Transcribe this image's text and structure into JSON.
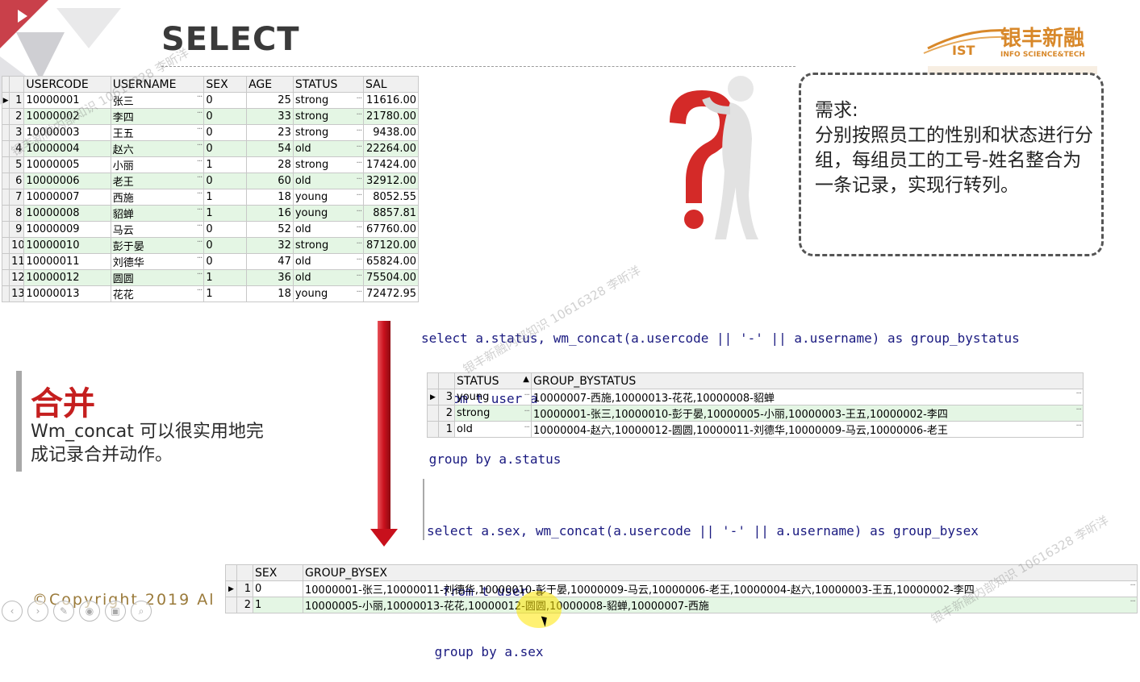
{
  "slide": {
    "title": "SELECT",
    "brand": {
      "name": "银丰新融",
      "abbr": "IST",
      "sub": "INFO SCIENCE&TECH"
    },
    "copyright": "©Copyright 2019 Al",
    "watermark": "银丰新融内部知识 10616328 李昕洋"
  },
  "user_table": {
    "columns": [
      "USERCODE",
      "USERNAME",
      "SEX",
      "AGE",
      "STATUS",
      "SAL"
    ],
    "rows": [
      {
        "n": "1",
        "code": "10000001",
        "name": "张三",
        "sex": "0",
        "age": "25",
        "status": "strong",
        "sal": "11616.00"
      },
      {
        "n": "2",
        "code": "10000002",
        "name": "李四",
        "sex": "0",
        "age": "33",
        "status": "strong",
        "sal": "21780.00"
      },
      {
        "n": "3",
        "code": "10000003",
        "name": "王五",
        "sex": "0",
        "age": "23",
        "status": "strong",
        "sal": "9438.00"
      },
      {
        "n": "4",
        "code": "10000004",
        "name": "赵六",
        "sex": "0",
        "age": "54",
        "status": "old",
        "sal": "22264.00"
      },
      {
        "n": "5",
        "code": "10000005",
        "name": "小丽",
        "sex": "1",
        "age": "28",
        "status": "strong",
        "sal": "17424.00"
      },
      {
        "n": "6",
        "code": "10000006",
        "name": "老王",
        "sex": "0",
        "age": "60",
        "status": "old",
        "sal": "32912.00"
      },
      {
        "n": "7",
        "code": "10000007",
        "name": "西施",
        "sex": "1",
        "age": "18",
        "status": "young",
        "sal": "8052.55"
      },
      {
        "n": "8",
        "code": "10000008",
        "name": "貂蝉",
        "sex": "1",
        "age": "16",
        "status": "young",
        "sal": "8857.81"
      },
      {
        "n": "9",
        "code": "10000009",
        "name": "马云",
        "sex": "0",
        "age": "52",
        "status": "old",
        "sal": "67760.00"
      },
      {
        "n": "10",
        "code": "10000010",
        "name": "彭于晏",
        "sex": "0",
        "age": "32",
        "status": "strong",
        "sal": "87120.00"
      },
      {
        "n": "11",
        "code": "10000011",
        "name": "刘德华",
        "sex": "0",
        "age": "47",
        "status": "old",
        "sal": "65824.00"
      },
      {
        "n": "12",
        "code": "10000012",
        "name": "圆圆",
        "sex": "1",
        "age": "36",
        "status": "old",
        "sal": "75504.00"
      },
      {
        "n": "13",
        "code": "10000013",
        "name": "花花",
        "sex": "1",
        "age": "18",
        "status": "young",
        "sal": "72472.95"
      }
    ]
  },
  "requirement": {
    "title": "需求:",
    "body": "分别按照员工的性别和状态进行分组，每组员工的工号-姓名整合为一条记录，实现行转列。"
  },
  "sql_status": {
    "line1": "select a.status, wm_concat(a.usercode || '-' || a.username) as group_bystatus",
    "line2": "  from t_user a",
    "line3": " group by a.status"
  },
  "status_table": {
    "columns": [
      "STATUS",
      "GROUP_BYSTATUS"
    ],
    "rows": [
      {
        "n": "3",
        "status": "young",
        "group": "10000007-西施,10000013-花花,10000008-貂蝉"
      },
      {
        "n": "2",
        "status": "strong",
        "group": "10000001-张三,10000010-彭于晏,10000005-小丽,10000003-王五,10000002-李四"
      },
      {
        "n": "1",
        "status": "old",
        "group": "10000004-赵六,10000012-圆圆,10000011-刘德华,10000009-马云,10000006-老王"
      }
    ]
  },
  "sql_sex": {
    "line1": "select a.sex, wm_concat(a.usercode || '-' || a.username) as group_bysex",
    "line2": "  from t_user a",
    "line3": " group by a.sex"
  },
  "sex_table": {
    "columns": [
      "SEX",
      "GROUP_BYSEX"
    ],
    "rows": [
      {
        "n": "1",
        "sex": "0",
        "group": "10000001-张三,10000011-刘德华,10000010-彭于晏,10000009-马云,10000006-老王,10000004-赵六,10000003-王五,10000002-李四"
      },
      {
        "n": "2",
        "sex": "1",
        "group": "10000005-小丽,10000013-花花,10000012-圆圆,10000008-貂蝉,10000007-西施"
      }
    ]
  },
  "merge": {
    "title": "合并",
    "desc": "Wm_concat 可以很实用地完成记录合并动作。"
  },
  "colors": {
    "accent_red": "#c51f1f",
    "row_alt": "#e4f6e4",
    "sql_blue": "#1a1a80"
  }
}
